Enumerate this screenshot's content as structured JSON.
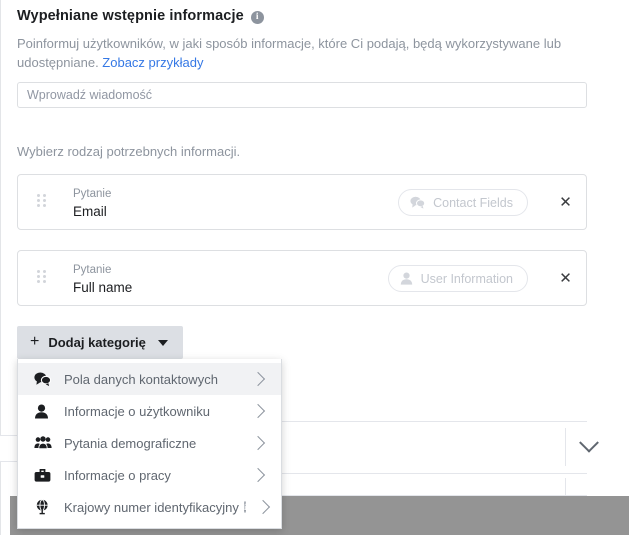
{
  "section": {
    "title": "Wypełniane wstępnie informacje",
    "info_icon": "info-icon",
    "description_before_link": "Poinformuj użytkowników, w jaki sposób informacje, które Ci podają, będą wykorzystywane lub udostępniane. ",
    "link_label": "Zobacz przykłady"
  },
  "message_input": {
    "placeholder": "Wprowadź wiadomość",
    "value": ""
  },
  "pick_label": "Wybierz rodzaj potrzebnych informacji.",
  "questions": [
    {
      "type_label": "Pytanie",
      "value": "Email",
      "pill_label": "Contact Fields",
      "pill_icon": "chat-bubbles-icon",
      "remove_label": "✕"
    },
    {
      "type_label": "Pytanie",
      "value": "Full name",
      "pill_label": "User Information",
      "pill_icon": "person-icon",
      "remove_label": "✕"
    }
  ],
  "add_category_button": {
    "plus": "+",
    "label": "Dodaj kategorię",
    "caret": "caret-down-icon"
  },
  "dropdown": {
    "items": [
      {
        "label": "Pola danych kontaktowych",
        "icon": "chat-bubbles-icon",
        "active": true,
        "has_info": false
      },
      {
        "label": "Informacje o użytkowniku",
        "icon": "person-icon",
        "active": false,
        "has_info": false
      },
      {
        "label": "Pytania demograficzne",
        "icon": "people-group-icon",
        "active": false,
        "has_info": false
      },
      {
        "label": "Informacje o pracy",
        "icon": "briefcase-icon",
        "active": false,
        "has_info": false
      },
      {
        "label": "Krajowy numer identyfikacyjny",
        "icon": "globe-icon",
        "active": false,
        "has_info": true
      }
    ]
  },
  "colors": {
    "link": "#3578e5",
    "text": "#1c1e21",
    "muted": "#8d949e",
    "border": "#dddfe2",
    "button_bg": "#dcdfe4",
    "overlay": "#949494"
  }
}
